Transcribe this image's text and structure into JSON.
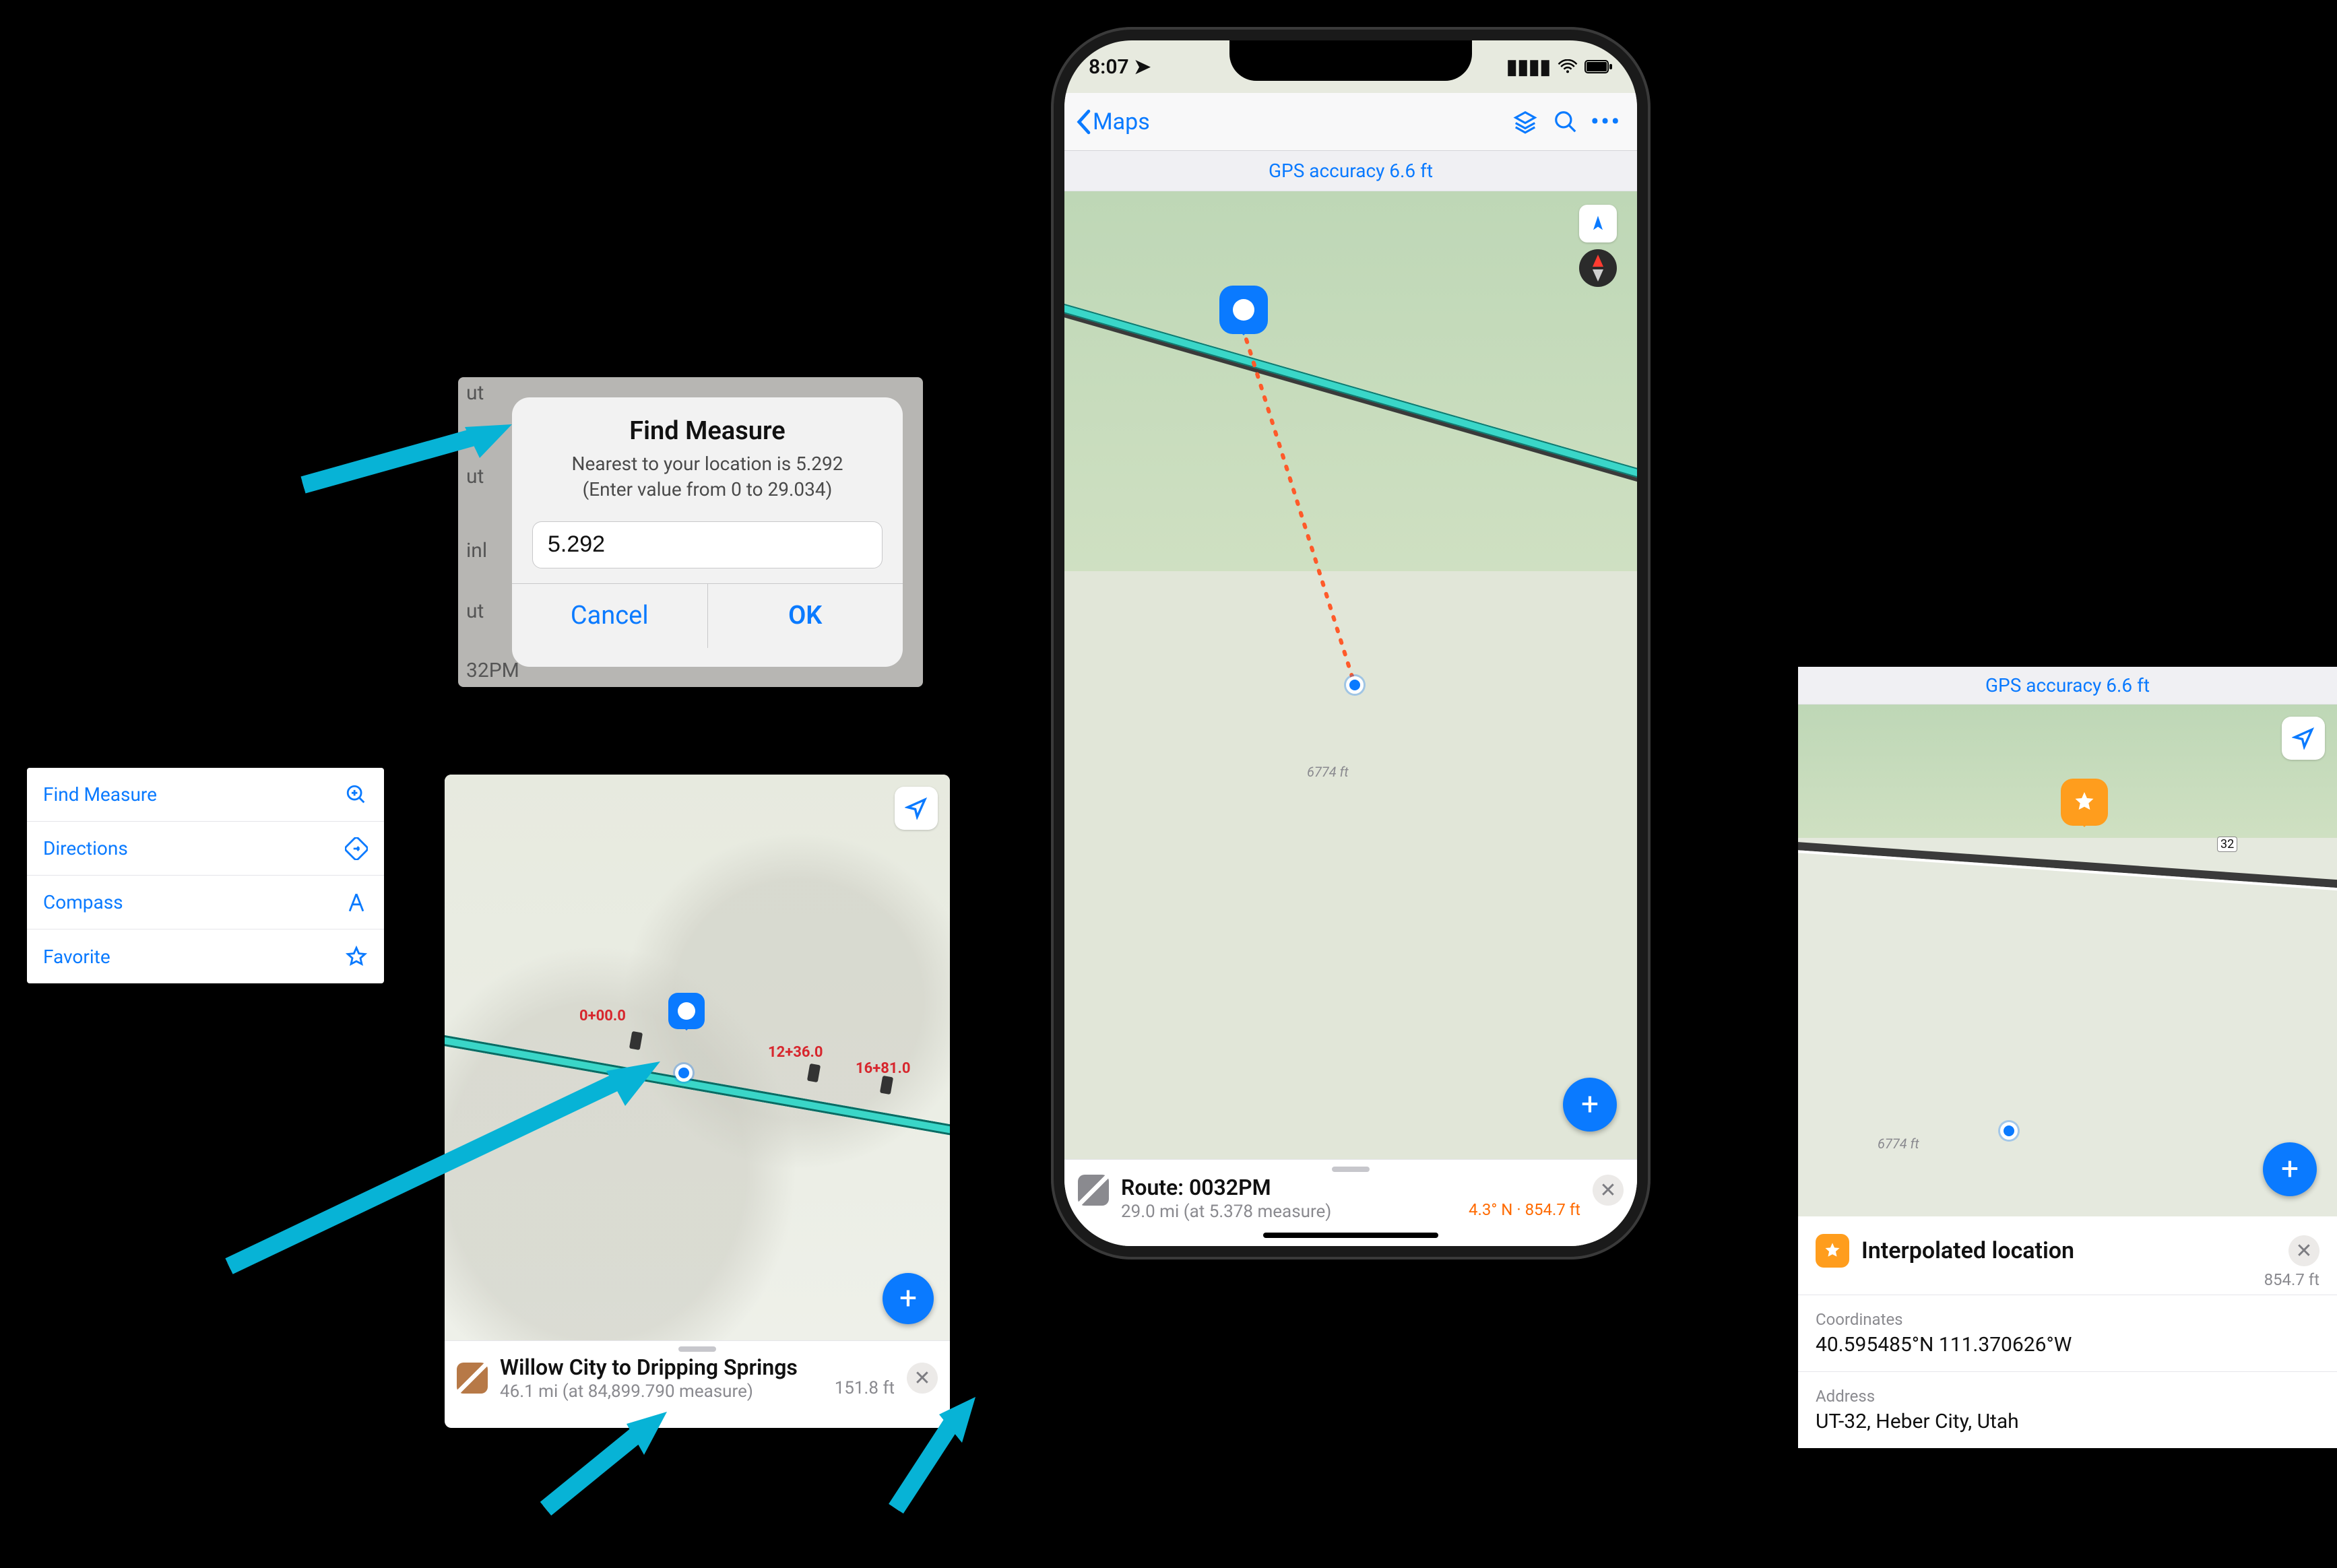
{
  "dialog": {
    "title": "Find Measure",
    "line1": "Nearest to your location is 5.292",
    "line2": "(Enter value from 0 to 29.034)",
    "value": "5.292",
    "cancel": "Cancel",
    "ok": "OK",
    "bg1": "ut",
    "bg2": "ut",
    "bg3": "inl",
    "bg4": "ut",
    "bg5": "32PM"
  },
  "menu": {
    "items": [
      {
        "label": "Find Measure",
        "icon": "search"
      },
      {
        "label": "Directions",
        "icon": "turn"
      },
      {
        "label": "Compass",
        "icon": "compass-a"
      },
      {
        "label": "Favorite",
        "icon": "star"
      }
    ]
  },
  "card1": {
    "title": "Willow City to Dripping Springs",
    "sub": "46.1 mi (at 84,899.790 measure)",
    "right": "151.8 ft",
    "labels": {
      "a": "0+00.0",
      "b": "12+36.0",
      "c": "16+81.0"
    }
  },
  "phone": {
    "time": "8:07",
    "back": "Maps",
    "gps": "GPS accuracy 6.6 ft",
    "elev": "6774 ft",
    "route": {
      "title": "Route: 0032PM",
      "sub": "29.0 mi (at 5.378 measure)",
      "right": "4.3° N · 854.7 ft"
    }
  },
  "interp": {
    "gps": "GPS accuracy 6.6 ft",
    "title": "Interpolated location",
    "ft": "854.7 ft",
    "coords_lbl": "Coordinates",
    "coords": "40.595485°N 111.370626°W",
    "addr_lbl": "Address",
    "addr": "UT-32, Heber City, Utah",
    "elev": "6774 ft",
    "road": "32"
  }
}
